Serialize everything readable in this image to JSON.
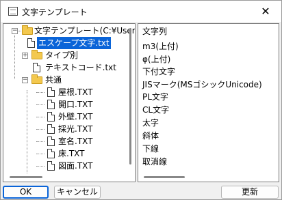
{
  "window": {
    "title": "文字テンプレート",
    "close_label": "✕"
  },
  "tree": {
    "root_label": "文字テンプレート(C:¥Users¥",
    "items": [
      {
        "label": "エスケープ文字.txt"
      },
      {
        "label": "タイプ別"
      },
      {
        "label": "テキストコード.txt"
      },
      {
        "label": "共通"
      },
      {
        "label": "屋根.TXT"
      },
      {
        "label": "開口.TXT"
      },
      {
        "label": "外壁.TXT"
      },
      {
        "label": "採光.TXT"
      },
      {
        "label": "室名.TXT"
      },
      {
        "label": "床.TXT"
      },
      {
        "label": "図面.TXT"
      }
    ]
  },
  "list": {
    "items": [
      "文字列",
      "m3(上付)",
      "φ(上付)",
      "下付文字",
      "JISマーク(MSゴシックUnicode)",
      "PL文字",
      "CL文字",
      "太字",
      "斜体",
      "下線",
      "取消線"
    ]
  },
  "buttons": {
    "ok": "OK",
    "cancel": "キャンセル",
    "update": "更新"
  }
}
